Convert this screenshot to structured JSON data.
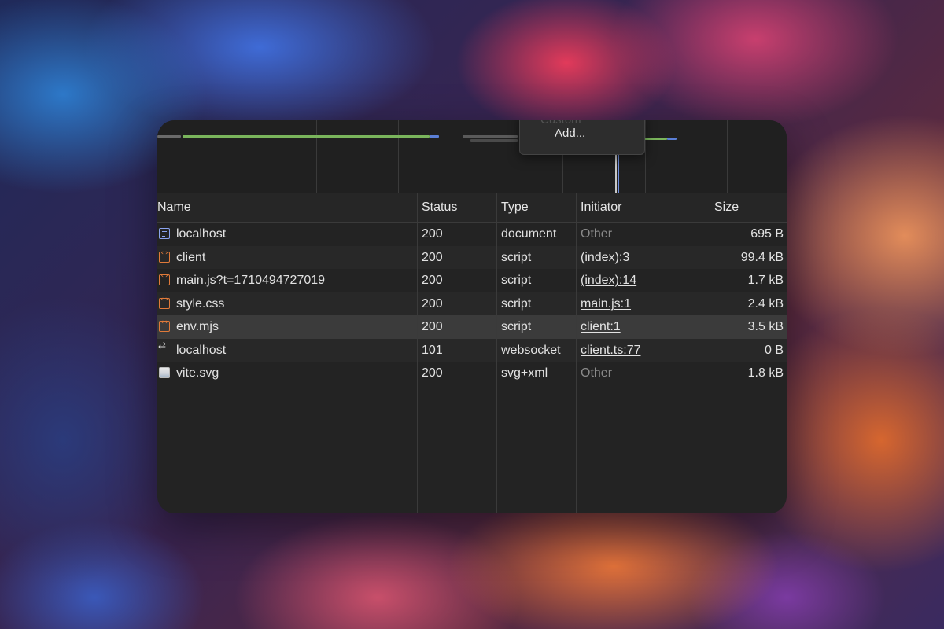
{
  "menu": {
    "ghost_label": "Custom",
    "add_label": "Add..."
  },
  "columns": {
    "name": "Name",
    "status": "Status",
    "type": "Type",
    "initiator": "Initiator",
    "size": "Size"
  },
  "rows": [
    {
      "name": "localhost",
      "icon": "document-icon",
      "status": "200",
      "type": "document",
      "initiator": "Other",
      "initiator_link": false,
      "size": "695 B"
    },
    {
      "name": "client",
      "icon": "script-icon",
      "status": "200",
      "type": "script",
      "initiator": "(index):3",
      "initiator_link": true,
      "size": "99.4 kB"
    },
    {
      "name": "main.js?t=1710494727019",
      "icon": "script-icon",
      "status": "200",
      "type": "script",
      "initiator": "(index):14",
      "initiator_link": true,
      "size": "1.7 kB"
    },
    {
      "name": "style.css",
      "icon": "script-icon",
      "status": "200",
      "type": "script",
      "initiator": "main.js:1",
      "initiator_link": true,
      "size": "2.4 kB"
    },
    {
      "name": "env.mjs",
      "icon": "script-icon",
      "status": "200",
      "type": "script",
      "initiator": "client:1",
      "initiator_link": true,
      "size": "3.5 kB"
    },
    {
      "name": "localhost",
      "icon": "websocket-icon",
      "status": "101",
      "type": "websocket",
      "initiator": "client.ts:77",
      "initiator_link": true,
      "size": "0 B"
    },
    {
      "name": "vite.svg",
      "icon": "image-icon",
      "status": "200",
      "type": "svg+xml",
      "initiator": "Other",
      "initiator_link": false,
      "size": "1.8 kB"
    }
  ],
  "selected_row": 4,
  "colors": {
    "panel_bg": "#232323",
    "waterfall_green": "#7ab55c",
    "waterfall_blue": "#5b7fd6",
    "document_icon": "#8ba4f0",
    "script_icon": "#e07a3a"
  }
}
